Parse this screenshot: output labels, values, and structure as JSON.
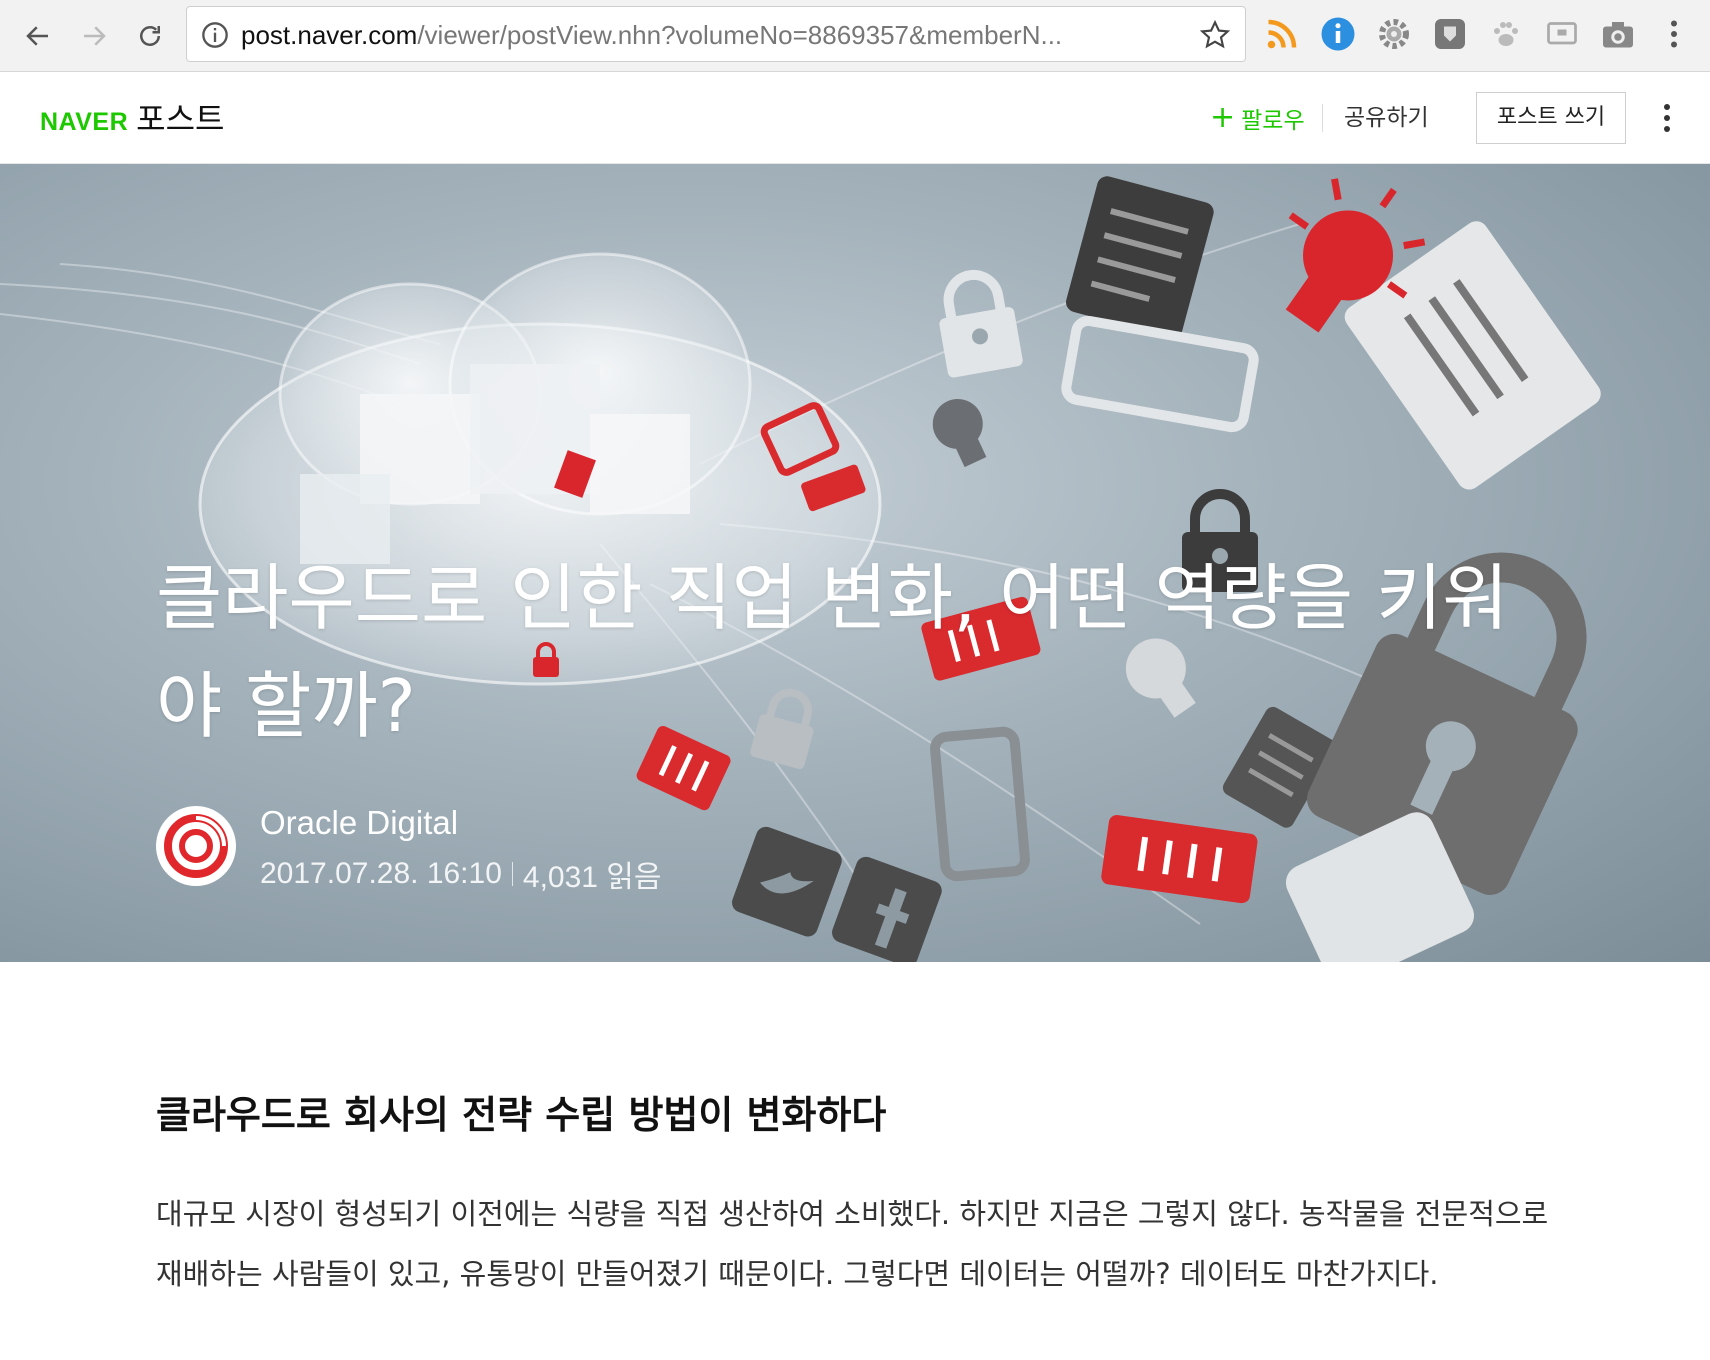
{
  "browser": {
    "url_host": "post.naver.com",
    "url_path": "/viewer/postView.nhn?volumeNo=8869357&memberN...",
    "icons": [
      "back-arrow-icon",
      "forward-arrow-icon",
      "reload-icon",
      "info-icon",
      "bookmark-star-icon",
      "rss-icon",
      "info-extension-icon",
      "gear-extension-icon",
      "shield-extension-icon",
      "paw-extension-icon",
      "screen-extension-icon",
      "camera-extension-icon",
      "browser-menu-icon"
    ]
  },
  "header": {
    "brand_naver": "NAVER",
    "brand_post": "포스트",
    "follow_plus": "+",
    "follow_label": "팔로우",
    "share_label": "공유하기",
    "write_label": "포스트 쓰기"
  },
  "hero": {
    "title": "클라우드로 인한 직업 변화, 어떤 역량을 키워야 할까?",
    "author": "Oracle Digital",
    "date": "2017.07.28. 16:10",
    "reads": "4,031 읽음"
  },
  "article": {
    "heading": "클라우드로 회사의 전략 수립 방법이 변화하다",
    "paragraph": "대규모 시장이 형성되기 이전에는 식량을 직접 생산하여 소비했다. 하지만 지금은 그렇지 않다. 농작물을 전문적으로 재배하는 사람들이 있고, 유통망이 만들어졌기 때문이다. 그렇다면 데이터는 어떨까? 데이터도 마찬가지다."
  },
  "colors": {
    "naver_green": "#1ec800",
    "oracle_red": "#e0282c",
    "hero_bg": "#97a6af"
  }
}
